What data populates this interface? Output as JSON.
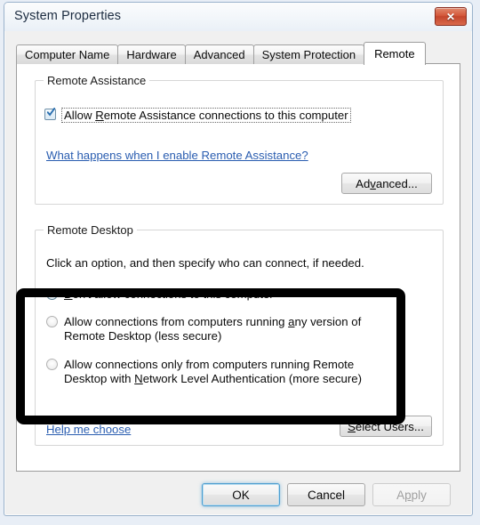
{
  "window": {
    "title": "System Properties",
    "close_label": "✕",
    "close_icon": "close-icon"
  },
  "tabs": [
    {
      "label": "Computer Name",
      "active": false
    },
    {
      "label": "Hardware",
      "active": false
    },
    {
      "label": "Advanced",
      "active": false
    },
    {
      "label": "System Protection",
      "active": false
    },
    {
      "label": "Remote",
      "active": true
    }
  ],
  "remote_assistance": {
    "group_label": "Remote Assistance",
    "checkbox": {
      "label_before": "Allow ",
      "accel": "R",
      "label_after": "emote Assistance connections to this computer",
      "checked": true
    },
    "link": "What happens when I enable Remote Assistance?",
    "advanced_button": {
      "before": "Ad",
      "accel": "v",
      "after": "anced..."
    }
  },
  "remote_desktop": {
    "group_label": "Remote Desktop",
    "instruction": "Click an option, and then specify who can connect, if needed.",
    "options": [
      {
        "selected": true,
        "line1_before": "",
        "accel": "D",
        "line1_after": "on't allow connections to this computer",
        "line2": ""
      },
      {
        "selected": false,
        "line1_before": "Allow connections from computers running ",
        "accel": "a",
        "line1_after": "ny version of",
        "line2": "Remote Desktop (less secure)"
      },
      {
        "selected": false,
        "line1_before": "Allow connections only from computers running Remote",
        "accel": "",
        "line1_after": "",
        "line2_before": "Desktop with ",
        "accel2": "N",
        "line2_after": "etwork Level Authentication (more secure)"
      }
    ],
    "help_link": "Help me choose",
    "select_users_button": {
      "before": "",
      "accel": "S",
      "after": "elect Users..."
    }
  },
  "footer": {
    "ok": "OK",
    "cancel": "Cancel",
    "apply_before": "A",
    "apply_accel": "p",
    "apply_after": "ply",
    "apply_disabled": true
  },
  "annotation": {
    "shape": "rectangle",
    "color": "#000000"
  },
  "colors": {
    "link": "#2a5db0",
    "close_button": "#c4452c",
    "radio_selected": "#1f6fa8",
    "checkbox_check": "#2a6fb0",
    "annotation": "#000000",
    "dialog_bg": "#f0f0f0",
    "panel_bg": "#ffffff"
  }
}
